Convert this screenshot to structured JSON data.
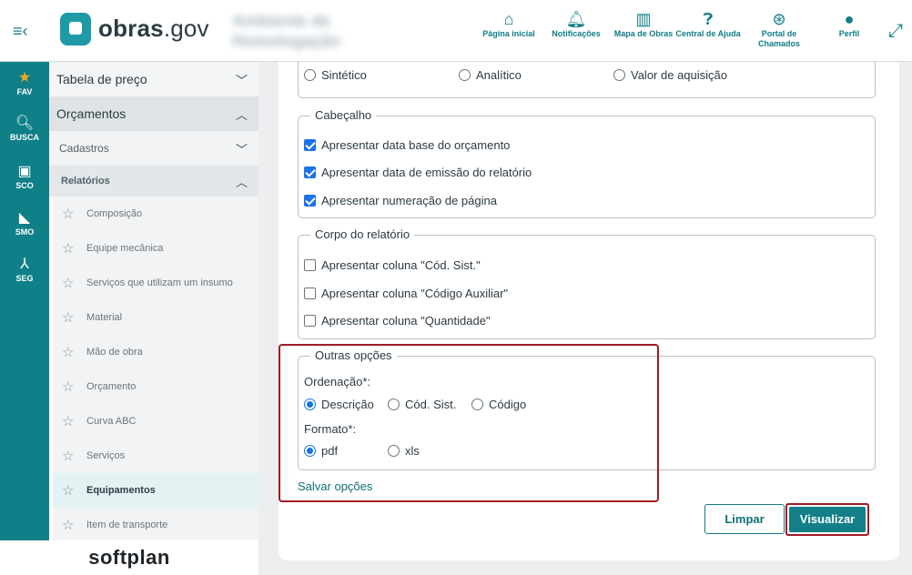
{
  "header": {
    "menu_icon": "menu-collapse-icon",
    "logo_brand": "obras",
    "logo_suffix": ".gov",
    "environment_label": "Ambiente de Homologação",
    "nav": [
      {
        "icon": "home-icon",
        "label": "Página inicial"
      },
      {
        "icon": "bell-icon",
        "label": "Notificações"
      },
      {
        "icon": "map-icon",
        "label": "Mapa de Obras"
      },
      {
        "icon": "help-icon",
        "label": "Central de Ajuda"
      },
      {
        "icon": "lifebuoy-icon",
        "label": "Portal de Chamados"
      },
      {
        "icon": "user-icon",
        "label": "Perfil"
      }
    ],
    "expand_icon": "expand-icon"
  },
  "rail": [
    {
      "icon": "star-icon",
      "label": "FAV"
    },
    {
      "icon": "search-icon",
      "label": "BUSCA"
    },
    {
      "icon": "money-icon",
      "label": "SCO"
    },
    {
      "icon": "ruler-icon",
      "label": "SMO"
    },
    {
      "icon": "merge-icon",
      "label": "SEG"
    }
  ],
  "sidebar": {
    "tabela": "Tabela de preço",
    "orcamentos": "Orçamentos",
    "cadastros": "Cadastros",
    "relatorios": "Relatórios",
    "items": [
      "Composição",
      "Equipe mecânica",
      "Serviços que utilizam um insumo",
      "Material",
      "Mão de obra",
      "Orçamento",
      "Curva ABC",
      "Serviços",
      "Equipamentos",
      "Item de transporte"
    ],
    "active_item": "Equipamentos",
    "footer_brand": "softplan"
  },
  "form": {
    "tipo": {
      "options": [
        "Sintético",
        "Analítico",
        "Valor de aquisição"
      ]
    },
    "cabecalho": {
      "legend": "Cabeçalho",
      "options": [
        {
          "label": "Apresentar data base do orçamento",
          "checked": true
        },
        {
          "label": "Apresentar data de emissão do relatório",
          "checked": true
        },
        {
          "label": "Apresentar numeração de página",
          "checked": true
        }
      ]
    },
    "corpo": {
      "legend": "Corpo do relatório",
      "options": [
        {
          "label": "Apresentar coluna \"Cód. Sist.\"",
          "checked": false
        },
        {
          "label": "Apresentar coluna \"Código Auxiliar\"",
          "checked": false
        },
        {
          "label": "Apresentar coluna \"Quantidade\"",
          "checked": false
        }
      ]
    },
    "outras": {
      "legend": "Outras opções",
      "ordenacao_label": "Ordenação*:",
      "ordenacao_options": [
        "Descrição",
        "Cód. Sist.",
        "Código"
      ],
      "ordenacao_selected": "Descrição",
      "formato_label": "Formato*:",
      "formato_options": [
        "pdf",
        "xls"
      ],
      "formato_selected": "pdf"
    },
    "save_link": "Salvar opções",
    "clear_button": "Limpar",
    "view_button": "Visualizar"
  },
  "colors": {
    "primary": "#0f7f88",
    "highlight": "#a11b26",
    "star": "#f5a623"
  }
}
